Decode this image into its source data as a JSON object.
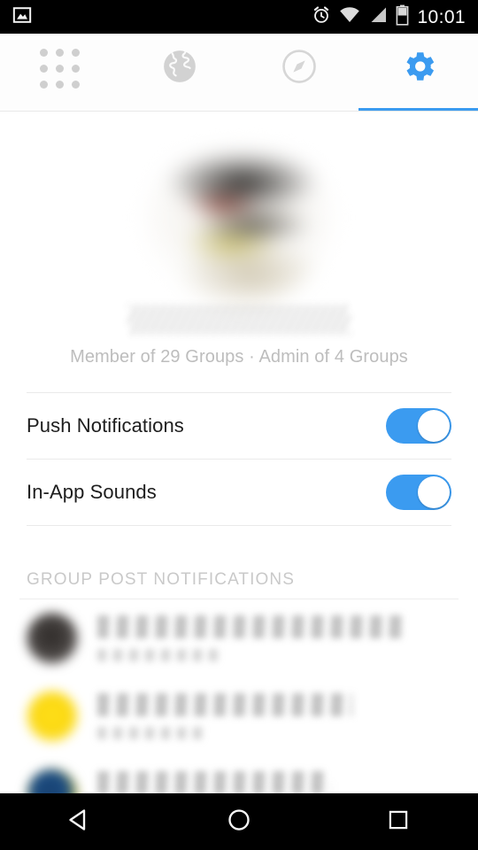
{
  "status_bar": {
    "notification_icon": "photo-icon",
    "time": "10:01",
    "icons": [
      "alarm-icon",
      "wifi-icon",
      "cellular-signal-icon",
      "battery-icon"
    ]
  },
  "tabs": [
    {
      "name": "apps-grid",
      "icon": "grid-icon",
      "selected": false
    },
    {
      "name": "globe",
      "icon": "globe-icon",
      "selected": false
    },
    {
      "name": "discover",
      "icon": "compass-icon",
      "selected": false
    },
    {
      "name": "settings",
      "icon": "gear-icon",
      "selected": true
    }
  ],
  "profile": {
    "avatar": "blurred-profile-photo",
    "name": "",
    "member_line": "Member of 29 Groups · Admin of 4 Groups"
  },
  "settings_rows": [
    {
      "label": "Push Notifications",
      "toggle_on": true
    },
    {
      "label": "In-App Sounds",
      "toggle_on": true
    }
  ],
  "section": {
    "header": "GROUP POST NOTIFICATIONS"
  },
  "group_rows": [
    {
      "avatar": "dark-group-avatar",
      "title": "",
      "subtitle": ""
    },
    {
      "avatar": "yellow-group-avatar",
      "title": "",
      "subtitle": ""
    },
    {
      "avatar": "blue-group-avatar",
      "title": "",
      "subtitle": ""
    }
  ],
  "nav_bar": {
    "back": "back-triangle-icon",
    "home": "home-circle-icon",
    "recents": "recents-square-icon"
  },
  "colors": {
    "accent": "#3b9bf0",
    "inactive_icon": "#cfcfcf",
    "text_primary": "#1d1d1d",
    "text_muted": "#bdbdbd",
    "divider": "#eaeaea",
    "status_bar_bg": "#000000"
  }
}
